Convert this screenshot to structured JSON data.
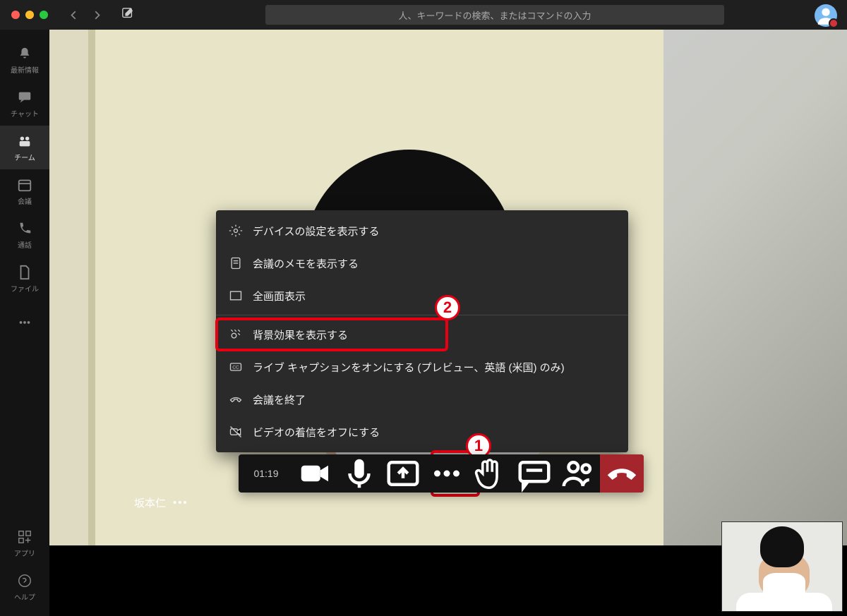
{
  "search": {
    "placeholder": "人、キーワードの検索、またはコマンドの入力"
  },
  "sidebar": {
    "items": [
      {
        "label": "最新情報"
      },
      {
        "label": "チャット"
      },
      {
        "label": "チーム"
      },
      {
        "label": "会議"
      },
      {
        "label": "通話"
      },
      {
        "label": "ファイル"
      }
    ],
    "bottom": [
      {
        "label": "アプリ"
      },
      {
        "label": "ヘルプ"
      }
    ]
  },
  "participant": {
    "name": "坂本仁"
  },
  "callbar": {
    "time": "01:19"
  },
  "menu": {
    "items": [
      {
        "label": "デバイスの設定を表示する"
      },
      {
        "label": "会議のメモを表示する"
      },
      {
        "label": "全画面表示"
      },
      {
        "label": "背景効果を表示する"
      },
      {
        "label": "ライブ キャプションをオンにする (プレビュー、英語 (米国) のみ)"
      },
      {
        "label": "会議を終了"
      },
      {
        "label": "ビデオの着信をオフにする"
      }
    ]
  },
  "annotations": {
    "one": "1",
    "two": "2"
  }
}
